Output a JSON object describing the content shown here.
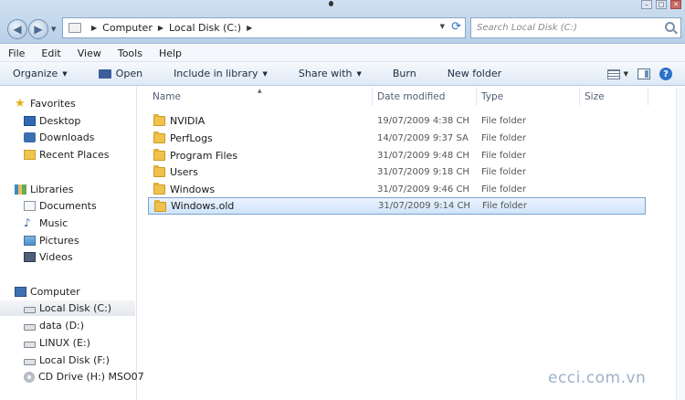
{
  "address": {
    "crumbs": [
      "Computer",
      "Local Disk (C:)"
    ]
  },
  "search": {
    "placeholder": "Search Local Disk (C:)"
  },
  "menu": [
    "File",
    "Edit",
    "View",
    "Tools",
    "Help"
  ],
  "toolbar": {
    "organize": "Organize",
    "open": "Open",
    "include": "Include in library",
    "share": "Share with",
    "burn": "Burn",
    "new_folder": "New folder"
  },
  "nav": {
    "favorites": "Favorites",
    "desktop": "Desktop",
    "downloads": "Downloads",
    "recent": "Recent Places",
    "libraries": "Libraries",
    "documents": "Documents",
    "music": "Music",
    "pictures": "Pictures",
    "videos": "Videos",
    "computer": "Computer",
    "drive_c": "Local Disk (C:)",
    "drive_d": "data (D:)",
    "drive_e": "LINUX (E:)",
    "drive_f": "Local Disk (F:)",
    "drive_h": "CD Drive (H:) MSO07"
  },
  "columns": {
    "name": "Name",
    "date": "Date modified",
    "type": "Type",
    "size": "Size"
  },
  "files": [
    {
      "name": "NVIDIA",
      "date": "19/07/2009 4:38 CH",
      "type": "File folder"
    },
    {
      "name": "PerfLogs",
      "date": "14/07/2009 9:37 SA",
      "type": "File folder"
    },
    {
      "name": "Program Files",
      "date": "31/07/2009 9:48 CH",
      "type": "File folder"
    },
    {
      "name": "Users",
      "date": "31/07/2009 9:18 CH",
      "type": "File folder"
    },
    {
      "name": "Windows",
      "date": "31/07/2009 9:46 CH",
      "type": "File folder"
    },
    {
      "name": "Windows.old",
      "date": "31/07/2009 9:14 CH",
      "type": "File folder"
    }
  ],
  "watermark": "ecci.com.vn"
}
